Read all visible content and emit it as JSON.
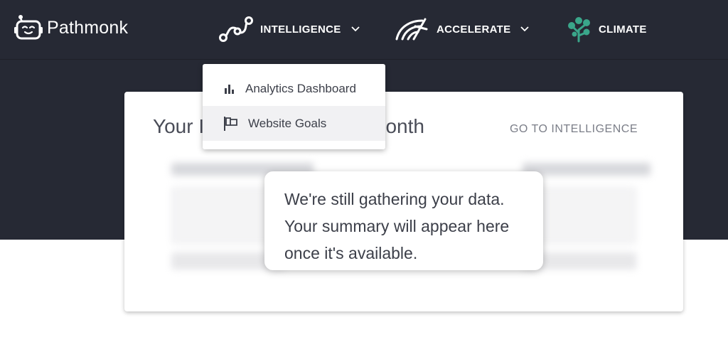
{
  "brand": {
    "name": "Pathmonk"
  },
  "nav": [
    {
      "label": "INTELLIGENCE",
      "icon": "intelligence-path-icon",
      "has_dropdown": true
    },
    {
      "label": "ACCELERATE",
      "icon": "accelerate-speed-icon",
      "has_dropdown": true
    },
    {
      "label": "CLIMATE",
      "icon": "climate-tree-icon",
      "has_dropdown": false,
      "icon_color": "#3aa68a"
    }
  ],
  "dropdown": {
    "items": [
      {
        "label": "Analytics Dashboard",
        "icon": "bar-chart-icon"
      },
      {
        "label": "Website Goals",
        "icon": "flag-icon",
        "highlighted": true
      }
    ]
  },
  "card": {
    "title_left": "Your I",
    "title_right": "Month",
    "link": "GO TO INTELLIGENCE"
  },
  "tooltip": {
    "line1": "We're still gathering your data.",
    "line2": "Your summary will appear here",
    "line3": "once it's available."
  },
  "colors": {
    "header_bg": "#262934",
    "climate_green": "#3aa68a"
  }
}
